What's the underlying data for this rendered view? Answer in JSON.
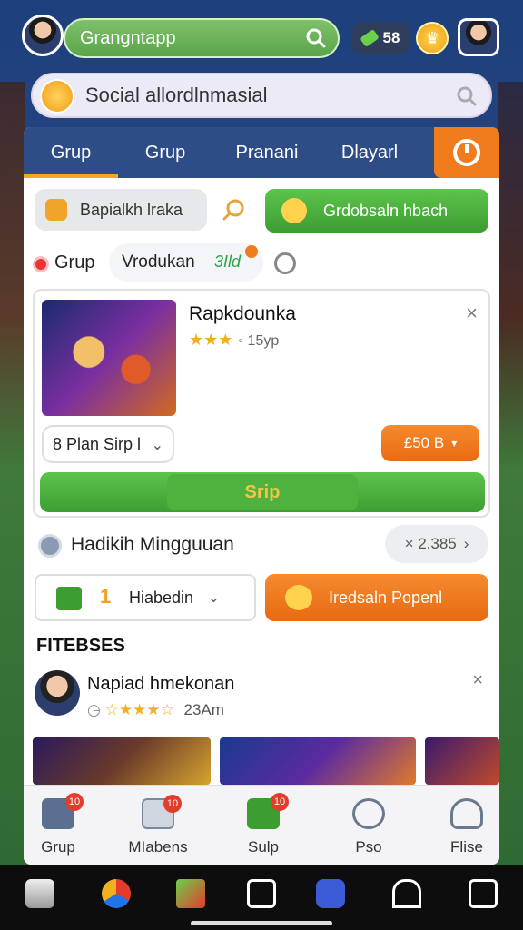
{
  "top": {
    "search_text": "Grangntapp",
    "coins": "58"
  },
  "social": {
    "text": "Social allordlnmasial"
  },
  "tabs": [
    {
      "label": "Grup"
    },
    {
      "label": "Grup"
    },
    {
      "label": "Pranani"
    },
    {
      "label": "Dlayarl"
    }
  ],
  "filters": {
    "grey_pill": "Bapialkh lraka",
    "green_button": "Grdobsaln hbach"
  },
  "row2": {
    "label": "Grup",
    "chip": "Vrodukan",
    "chip_green": "3Ild"
  },
  "product": {
    "title": "Rapkdounka",
    "stars": "★★★",
    "meta": "◦ 15yp",
    "select": "8 Plan Sirp l",
    "price": "£50 B",
    "action": "Srip",
    "close": "×"
  },
  "row3": {
    "label": "Hadikih Mingguuan",
    "pill": "× 2.385"
  },
  "row4": {
    "select_num": "1",
    "select_text": "Hiabedin",
    "orange_button": "Iredsaln Popenl"
  },
  "section": {
    "title": "FITEBSES"
  },
  "review": {
    "name": "Napiad hmekonan",
    "stars": "☆★★★☆",
    "meta": "23Am",
    "close": "×"
  },
  "bottom_nav": [
    {
      "label": "Grup",
      "badge": "10",
      "icon": "home-icon"
    },
    {
      "label": "MIabens",
      "badge": "10",
      "icon": "gallery-icon"
    },
    {
      "label": "Sulp",
      "badge": "10",
      "icon": "check-icon"
    },
    {
      "label": "Pso",
      "badge": "",
      "icon": "pin-icon"
    },
    {
      "label": "Flise",
      "badge": "",
      "icon": "profile-icon"
    }
  ],
  "colors": {
    "nav_blue": "#2e4c86",
    "accent_orange": "#f07c1e",
    "accent_green": "#4fb23e",
    "star_gold": "#f2b01e"
  }
}
